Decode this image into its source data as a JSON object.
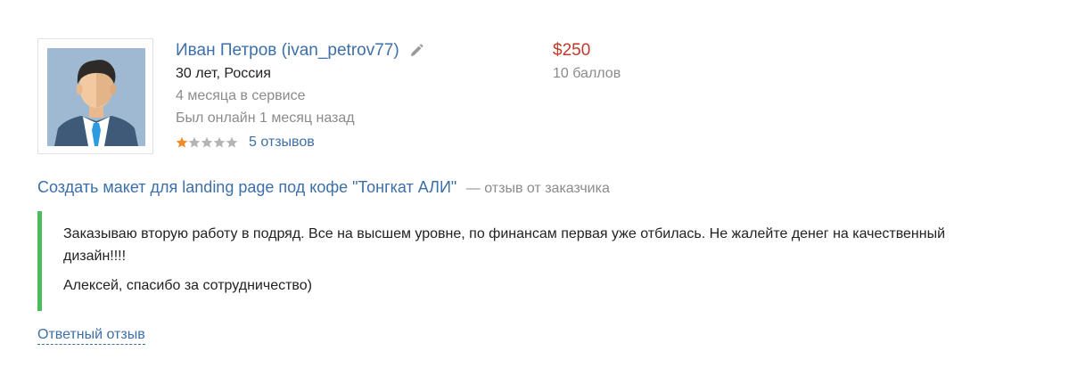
{
  "profile": {
    "name": "Иван Петров (ivan_petrov77)",
    "age_country": "30 лет, Россия",
    "service_time": "4 месяца в сервисе",
    "last_online": "Был онлайн 1 месяц назад",
    "rating_stars": 1,
    "rating_max": 5,
    "reviews_link": "5 отзывов",
    "avatar_icon": "user-avatar-icon",
    "edit_icon": "pencil-icon"
  },
  "price": {
    "amount": "$250",
    "points": "10 баллов"
  },
  "review": {
    "title": "Создать макет для landing page под кофе \"Тонгкат АЛИ\"",
    "meta": "— отзыв от заказчика",
    "paragraphs": [
      "Заказываю вторую работу в подряд. Все на высшем уровне, по финансам первая уже отбилась. Не жалейте денег на качественный дизайн!!!!",
      "Алексей, спасибо за сотрудничество)"
    ],
    "reply_link": "Ответный отзыв"
  },
  "colors": {
    "link": "#3d6fa8",
    "price": "#c0392b",
    "muted": "#8b8b8b",
    "accent_border": "#4cbb5a",
    "star_filled": "#f08a24",
    "star_empty": "#b4b4b4"
  }
}
